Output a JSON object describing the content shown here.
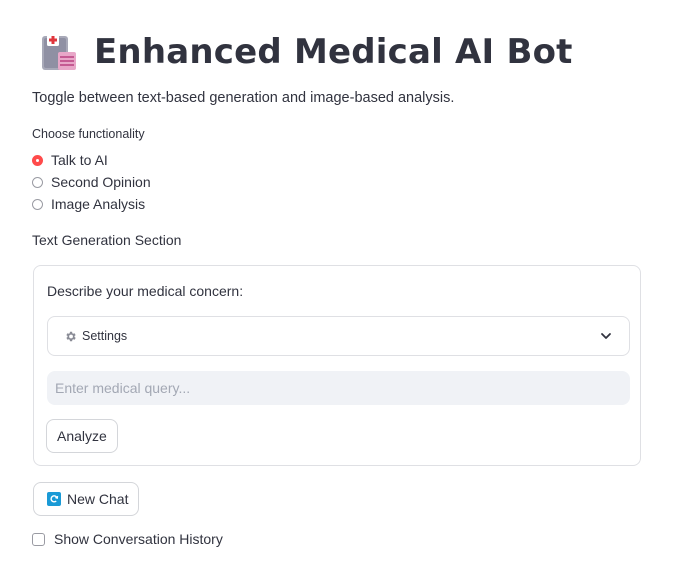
{
  "header": {
    "title": "Enhanced Medical AI Bot",
    "icon": "hospital-icon"
  },
  "subtitle": "Toggle between text-based generation and image-based analysis.",
  "functionality": {
    "label": "Choose functionality",
    "options": [
      "Talk to AI",
      "Second Opinion",
      "Image Analysis"
    ],
    "selected": "Talk to AI"
  },
  "section_title": "Text Generation Section",
  "form": {
    "prompt": "Describe your medical concern:",
    "settings_label": "Settings",
    "query_placeholder": "Enter medical query...",
    "query_value": "",
    "analyze_label": "Analyze"
  },
  "new_chat_label": "New Chat",
  "history_label": "Show Conversation History",
  "history_checked": false,
  "colors": {
    "accent": "#ff4b4b",
    "text": "#31333f",
    "input_bg": "#f0f2f6",
    "border": "#dfe0e4",
    "refresh": "#1a9ad6"
  }
}
